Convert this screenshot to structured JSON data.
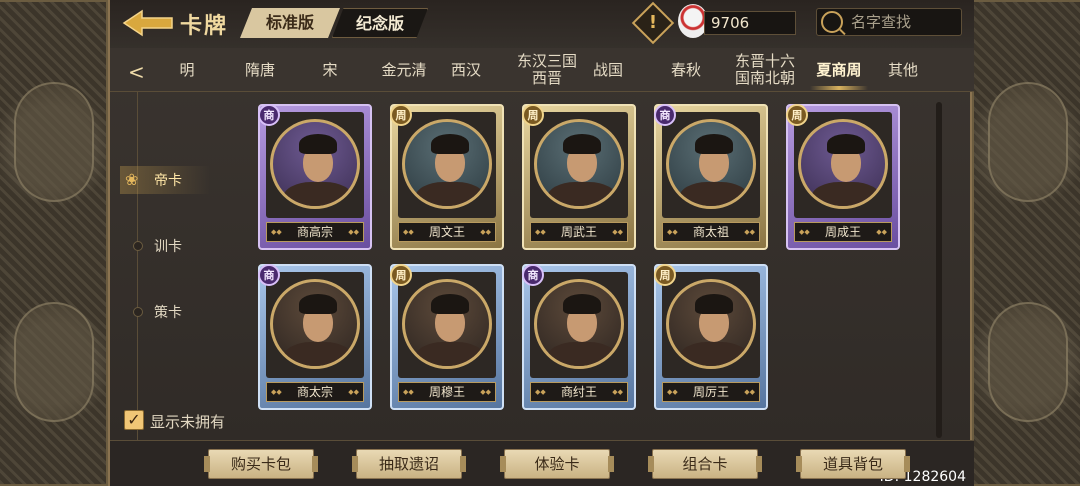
{
  "header": {
    "title": "卡牌",
    "tabs": {
      "standard": "标准版",
      "memorial": "纪念版"
    },
    "warning_icon": "!",
    "currency_value": "9706",
    "search_placeholder": "名字查找"
  },
  "eras": {
    "prev_icon": "chevron-left",
    "items": [
      "明",
      "隋唐",
      "宋",
      "金元清",
      "西汉",
      "东汉三国\n西晋",
      "战国",
      "春秋",
      "东晋十六\n国南北朝",
      "夏商周",
      "其他"
    ],
    "active": "夏商周"
  },
  "categories": {
    "items": [
      "帝卡",
      "训卡",
      "策卡"
    ],
    "active": "帝卡"
  },
  "cards": [
    {
      "name": "商高宗",
      "dynasty": "商",
      "frame": "purple"
    },
    {
      "name": "周文王",
      "dynasty": "周",
      "frame": "gold"
    },
    {
      "name": "周武王",
      "dynasty": "周",
      "frame": "gold"
    },
    {
      "name": "商太祖",
      "dynasty": "商",
      "frame": "gold"
    },
    {
      "name": "周成王",
      "dynasty": "周",
      "frame": "purple"
    },
    {
      "name": "商太宗",
      "dynasty": "商",
      "frame": "blue"
    },
    {
      "name": "周穆王",
      "dynasty": "周",
      "frame": "blue"
    },
    {
      "name": "商纣王",
      "dynasty": "商",
      "frame": "blue"
    },
    {
      "name": "周厉王",
      "dynasty": "周",
      "frame": "blue"
    }
  ],
  "show_unowned": {
    "label": "显示未拥有",
    "checked": true
  },
  "footer": {
    "buttons": [
      "购买卡包",
      "抽取遗诏",
      "体验卡",
      "组合卡",
      "道具背包"
    ],
    "id_text": "ID: 1282604"
  },
  "colors": {
    "accent": "#c9a25a",
    "active_text": "#ffe6a6"
  }
}
